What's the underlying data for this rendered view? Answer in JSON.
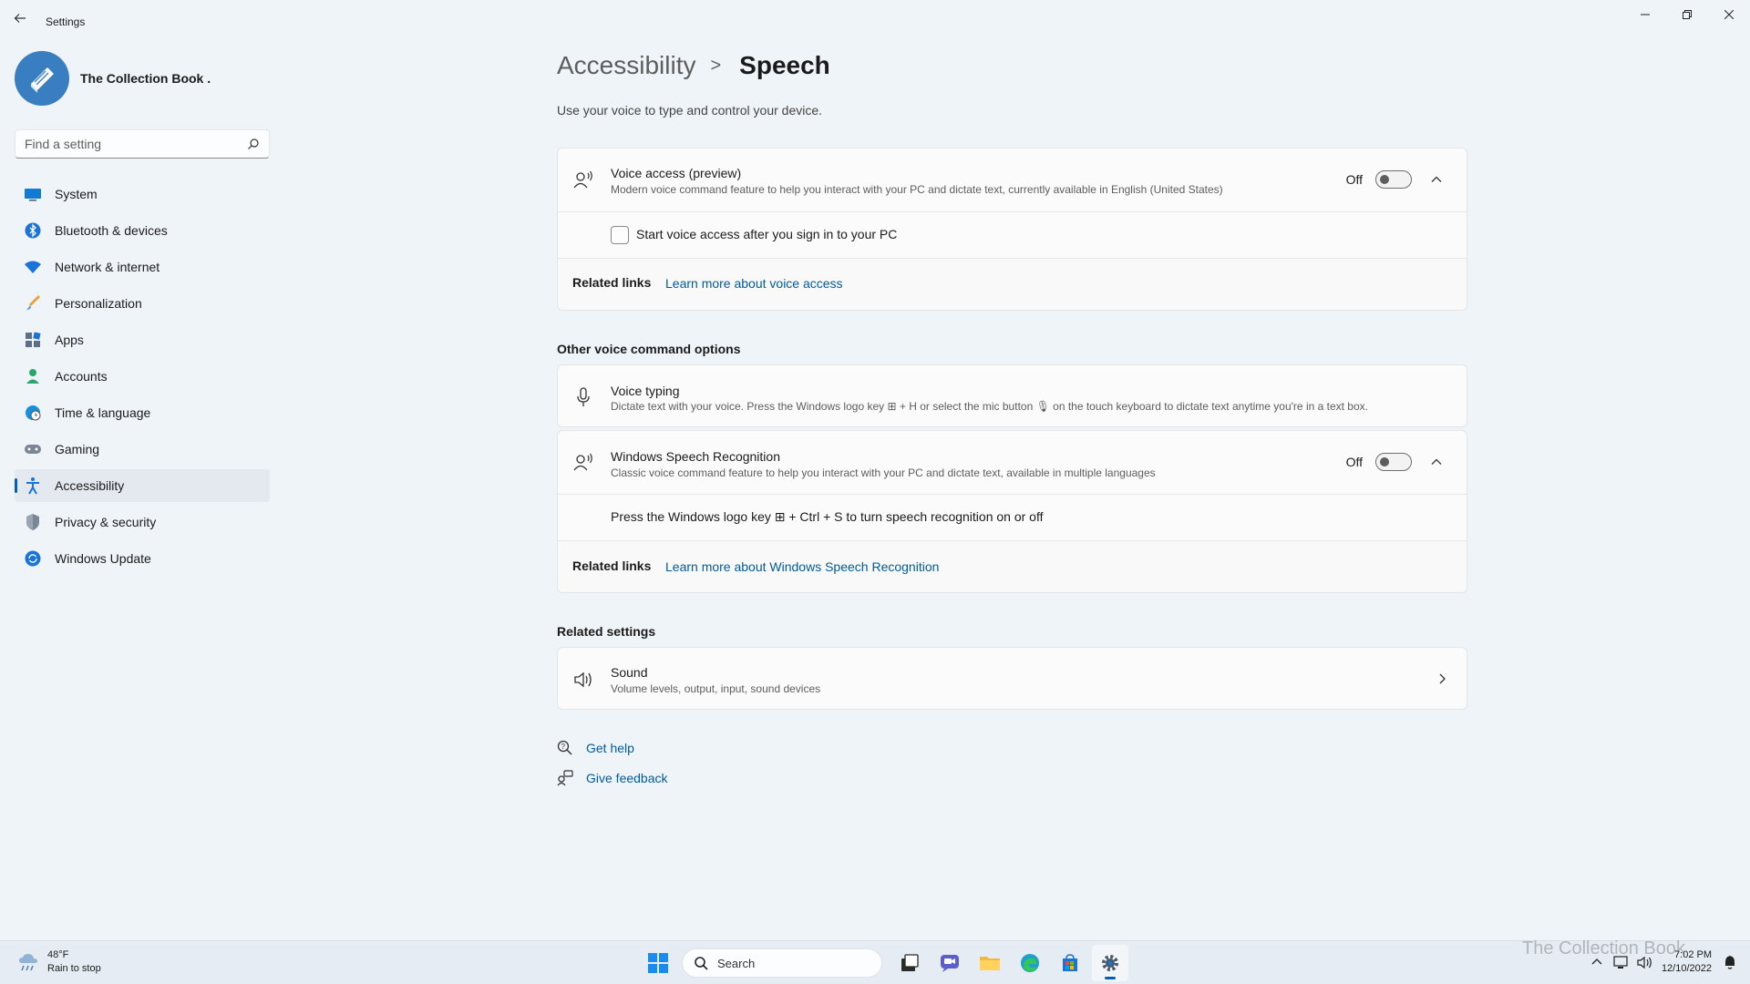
{
  "app": {
    "title": "Settings"
  },
  "profile": {
    "name": "The Collection Book ."
  },
  "search": {
    "placeholder": "Find a setting"
  },
  "sidebar": {
    "items": [
      {
        "label": "System",
        "icon": "monitor-icon"
      },
      {
        "label": "Bluetooth & devices",
        "icon": "bluetooth-icon"
      },
      {
        "label": "Network & internet",
        "icon": "wifi-icon"
      },
      {
        "label": "Personalization",
        "icon": "brush-icon"
      },
      {
        "label": "Apps",
        "icon": "apps-icon"
      },
      {
        "label": "Accounts",
        "icon": "person-icon"
      },
      {
        "label": "Time & language",
        "icon": "globe-clock-icon"
      },
      {
        "label": "Gaming",
        "icon": "gamepad-icon"
      },
      {
        "label": "Accessibility",
        "icon": "accessibility-icon",
        "selected": true
      },
      {
        "label": "Privacy & security",
        "icon": "shield-icon"
      },
      {
        "label": "Windows Update",
        "icon": "update-icon"
      }
    ]
  },
  "header": {
    "parent": "Accessibility",
    "separator": ">",
    "current": "Speech",
    "subtitle": "Use your voice to type and control your device."
  },
  "voice_access": {
    "title": "Voice access (preview)",
    "description": "Modern voice command feature to help you interact with your PC and dictate text, currently available in English (United States)",
    "toggle_state": "Off",
    "checkbox_label": "Start voice access after you sign in to your PC",
    "checkbox_checked": false,
    "related_label": "Related links",
    "related_link": "Learn more about voice access"
  },
  "other_options": {
    "heading": "Other voice command options",
    "voice_typing": {
      "title": "Voice typing",
      "description": "Dictate text with your voice. Press the Windows logo key ⊞ + H or select the mic button 🎙 on the touch keyboard to dictate text anytime you're in a text box."
    },
    "speech_recognition": {
      "title": "Windows Speech Recognition",
      "description": "Classic voice command feature to help you interact with your PC and dictate text, available in multiple languages",
      "toggle_state": "Off",
      "shortcut_text": "Press the Windows logo key ⊞ + Ctrl + S to turn speech recognition on or off",
      "related_label": "Related links",
      "related_link": "Learn more about Windows Speech Recognition"
    }
  },
  "related_settings": {
    "heading": "Related settings",
    "sound": {
      "title": "Sound",
      "description": "Volume levels, output, input, sound devices"
    }
  },
  "help": {
    "get_help": "Get help",
    "give_feedback": "Give feedback"
  },
  "taskbar": {
    "weather_temp": "48°F",
    "weather_desc": "Rain to stop",
    "search_label": "Search",
    "time": "7:02 PM",
    "date": "12/10/2022"
  },
  "watermark": "The Collection Book",
  "colors": {
    "accent": "#005fb8",
    "link": "#005a9e",
    "background": "#eff4f9"
  }
}
